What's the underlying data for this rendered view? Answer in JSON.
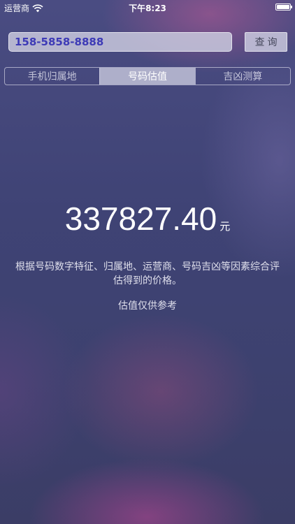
{
  "status_bar": {
    "carrier": "运营商",
    "time": "下午8:23",
    "wifi_icon": "wifi-icon",
    "battery_icon": "battery-icon"
  },
  "search": {
    "phone_number": "158-5858-8888",
    "query_label": "查询"
  },
  "tabs": [
    {
      "label": "手机归属地",
      "active": false
    },
    {
      "label": "号码估值",
      "active": true
    },
    {
      "label": "吉凶测算",
      "active": false
    }
  ],
  "result": {
    "amount": "337827.40",
    "unit": "元",
    "description": "根据号码数字特征、归属地、运营商、号码吉凶等因素综合评估得到的价格。",
    "disclaimer": "估值仅供参考"
  },
  "colors": {
    "input_text": "#3d3ab6",
    "background": "#3f4375",
    "accent_pink": "#be5a96"
  }
}
